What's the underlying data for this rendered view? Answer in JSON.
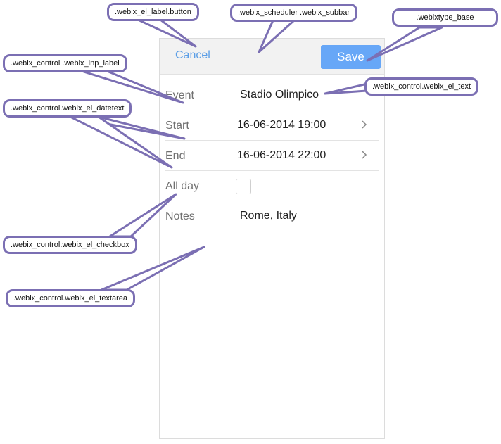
{
  "form": {
    "cancel_label": "Cancel",
    "save_label": "Save",
    "fields": [
      {
        "label": "Event",
        "value": "Stadio Olimpico"
      },
      {
        "label": "Start",
        "value": "16-06-2014 19:00"
      },
      {
        "label": "End",
        "value": "16-06-2014 22:00"
      },
      {
        "label": "All day",
        "checked": false
      },
      {
        "label": "Notes",
        "value": "Rome, Italy"
      }
    ]
  },
  "callouts": {
    "el_label_button": ".webix_el_label.button",
    "scheduler_subbar": ".webix_scheduler .webix_subbar",
    "type_base": ".webixtype_base",
    "inp_label": ".webix_control .webix_inp_label",
    "el_text": ".webix_control.webix_el_text",
    "el_datetext": ".webix_control.webix_el_datetext",
    "el_checkbox": ".webix_control.webix_el_checkbox",
    "el_textarea": ".webix_control.webix_el_textarea"
  },
  "colors": {
    "callout_border": "#7b6fb3",
    "accent": "#67a7f7",
    "link": "#5b9ee6"
  }
}
